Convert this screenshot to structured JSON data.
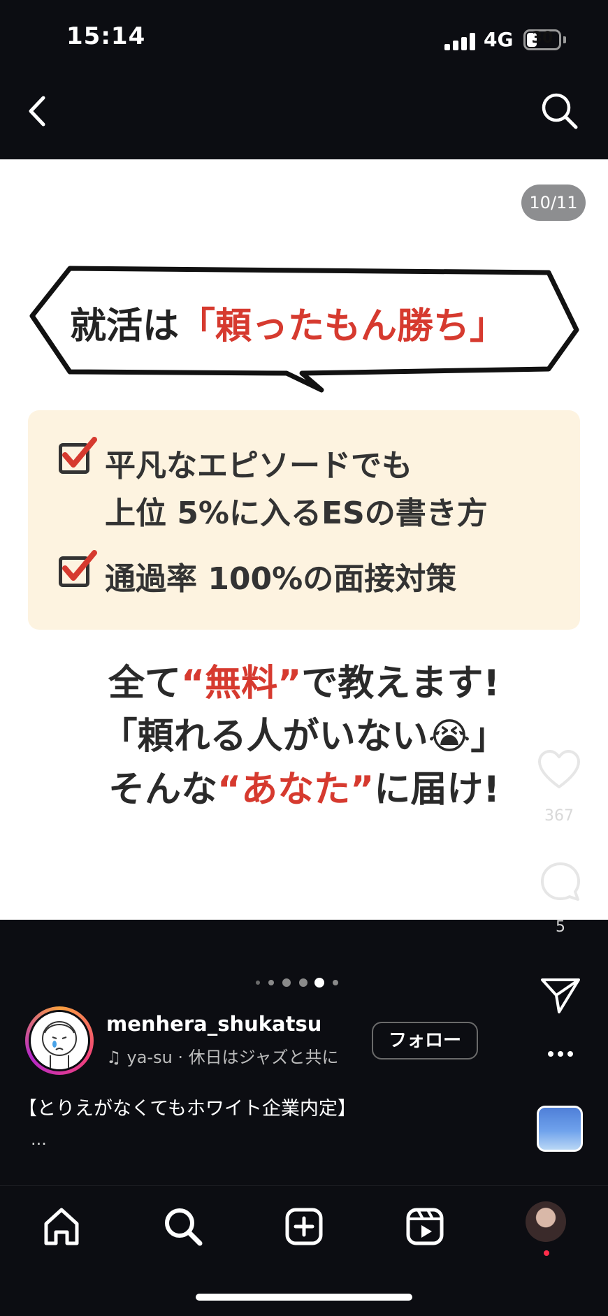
{
  "status_bar": {
    "time": "15:14",
    "network": "4G",
    "battery_level": "30",
    "battery_fraction": 0.3
  },
  "header": {
    "back_icon": "chevron-left-icon",
    "search_icon": "search-icon"
  },
  "post": {
    "page_counter": "10/11",
    "headline_prefix": "就活は",
    "headline_highlight": "「頼ったもん勝ち」",
    "checklist": [
      {
        "line1": "平凡なエピソードでも",
        "line2": "上位 5%に入るESの書き方"
      },
      {
        "line1": "通過率 100%の面接対策",
        "line2": ""
      }
    ],
    "message": {
      "line1_a": "全て",
      "line1_q_open": "“",
      "line1_highlight": "無料",
      "line1_q_close": "”",
      "line1_b": "で教えます!",
      "line2_a": "「頼れる人がいない",
      "line2_emoji": "😭",
      "line2_b": "」",
      "line3_a": "そんな",
      "line3_q_open": "“",
      "line3_highlight": "あなた",
      "line3_q_close": "”",
      "line3_b": "に届け!"
    },
    "accent_color": "#d63a2f",
    "box_color": "#fdf3e0"
  },
  "actions": {
    "likes": "367",
    "comments": "5"
  },
  "carousel": {
    "active_index": 4,
    "visible_dots": 6
  },
  "author": {
    "username": "menhera_shukatsu",
    "music": "ya-su · 休日はジャズと共に",
    "follow_label": "フォロー"
  },
  "caption": {
    "text": "【とりえがなくてもホワイト企業内定】",
    "more": "..."
  },
  "bottom_nav": {
    "items": [
      "home-icon",
      "search-icon",
      "create-icon",
      "reels-icon",
      "profile-avatar"
    ]
  }
}
